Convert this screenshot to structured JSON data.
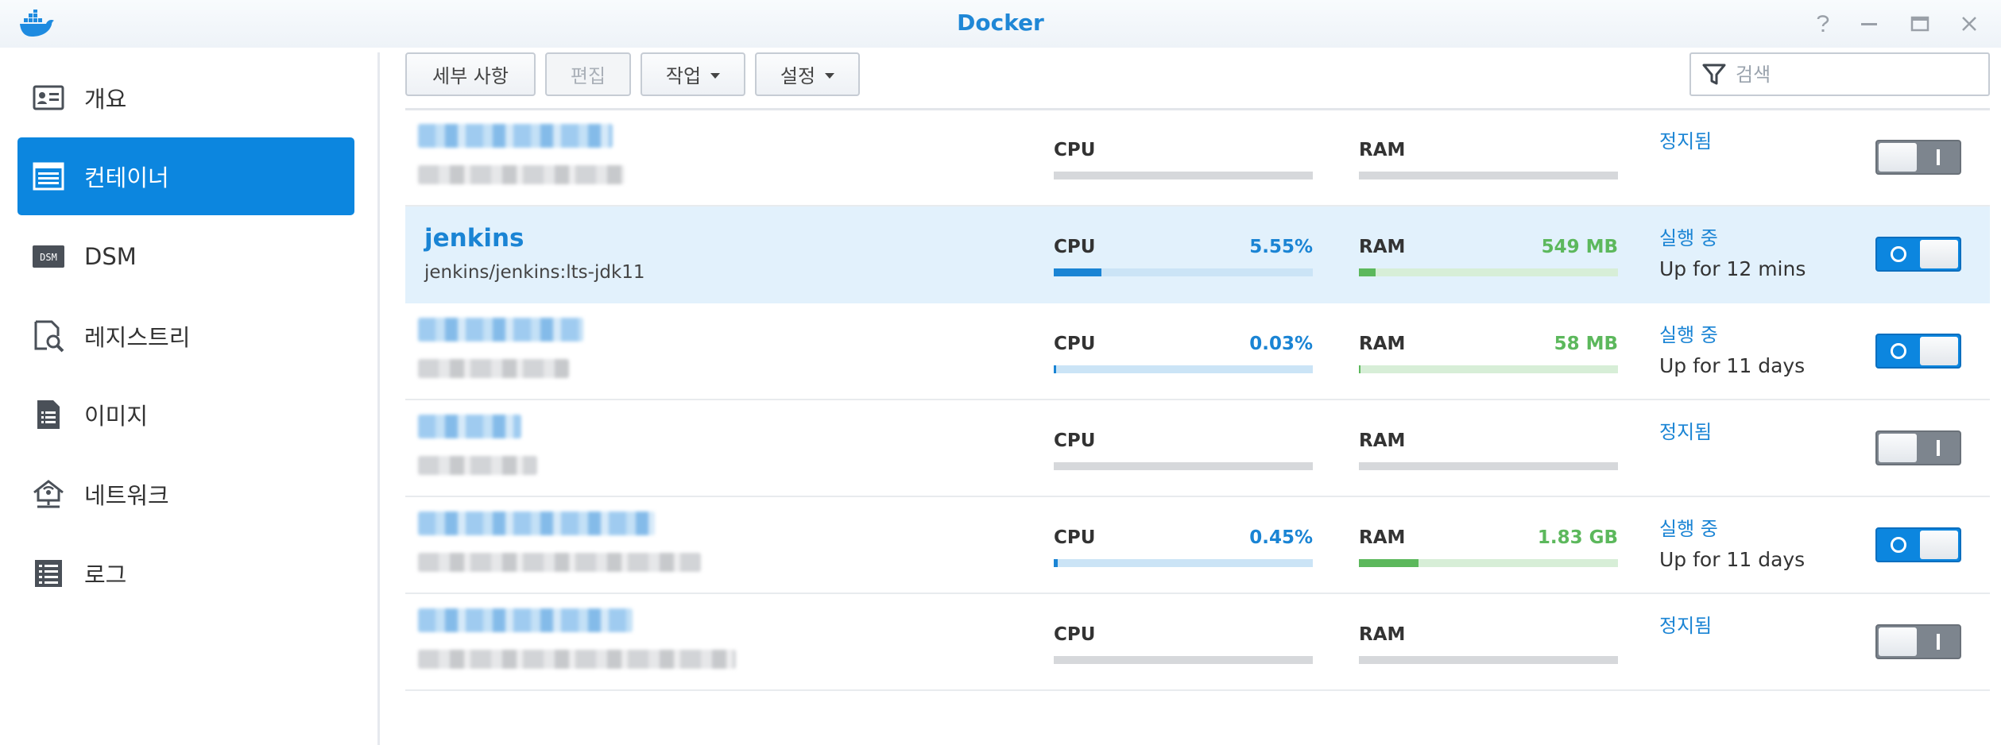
{
  "window": {
    "title": "Docker",
    "controls": [
      "help-icon",
      "minimize-icon",
      "maximize-icon",
      "close-icon"
    ]
  },
  "sidebar": {
    "items": [
      {
        "label": "개요",
        "icon": "overview-icon",
        "active": false
      },
      {
        "label": "컨테이너",
        "icon": "container-icon",
        "active": true
      },
      {
        "label": "DSM",
        "icon": "dsm-icon",
        "active": false
      },
      {
        "label": "레지스트리",
        "icon": "registry-icon",
        "active": false
      },
      {
        "label": "이미지",
        "icon": "image-icon",
        "active": false
      },
      {
        "label": "네트워크",
        "icon": "network-icon",
        "active": false
      },
      {
        "label": "로그",
        "icon": "log-icon",
        "active": false
      }
    ]
  },
  "toolbar": {
    "details_label": "세부 사항",
    "edit_label": "편집",
    "action_label": "작업",
    "settings_label": "설정",
    "search_placeholder": "검색"
  },
  "containers": [
    {
      "name": "",
      "image": "",
      "cpu_label": "CPU",
      "cpu_value": "",
      "cpu_fraction": 0,
      "ram_label": "RAM",
      "ram_value": "",
      "ram_fraction": 0,
      "status": "정지됨",
      "uptime": "",
      "running": false
    },
    {
      "name": "jenkins",
      "image": "jenkins/jenkins:lts-jdk11",
      "cpu_label": "CPU",
      "cpu_value": "5.55%",
      "cpu_fraction": 0.0555,
      "ram_label": "RAM",
      "ram_value": "549 MB",
      "ram_fraction": 0.065,
      "status": "실행 중",
      "uptime": "Up for 12 mins",
      "running": true
    },
    {
      "name": "",
      "image": "",
      "cpu_label": "CPU",
      "cpu_value": "0.03%",
      "cpu_fraction": 0.003,
      "ram_label": "RAM",
      "ram_value": "58 MB",
      "ram_fraction": 0.007,
      "status": "실행 중",
      "uptime": "Up for 11 days",
      "running": true
    },
    {
      "name": "",
      "image": "",
      "cpu_label": "CPU",
      "cpu_value": "",
      "cpu_fraction": 0,
      "ram_label": "RAM",
      "ram_value": "",
      "ram_fraction": 0,
      "status": "정지됨",
      "uptime": "",
      "running": false
    },
    {
      "name": "",
      "image": "",
      "cpu_label": "CPU",
      "cpu_value": "0.45%",
      "cpu_fraction": 0.0045,
      "ram_label": "RAM",
      "ram_value": "1.83 GB",
      "ram_fraction": 0.23,
      "status": "실행 중",
      "uptime": "Up for 11 days",
      "running": true
    },
    {
      "name": "",
      "image": "",
      "cpu_label": "CPU",
      "cpu_value": "",
      "cpu_fraction": 0,
      "ram_label": "RAM",
      "ram_value": "",
      "ram_fraction": 0,
      "status": "정지됨",
      "uptime": "",
      "running": false
    }
  ],
  "colors": {
    "accent": "#0c86df",
    "cpu_bar": "#1a84d4",
    "cpu_track_running": "#cbe4f6",
    "ram_bar": "#5cb85c",
    "ram_track_running": "#d7eed7",
    "track_stopped": "#d6d8db",
    "selected_row": "#e2f1fc"
  }
}
